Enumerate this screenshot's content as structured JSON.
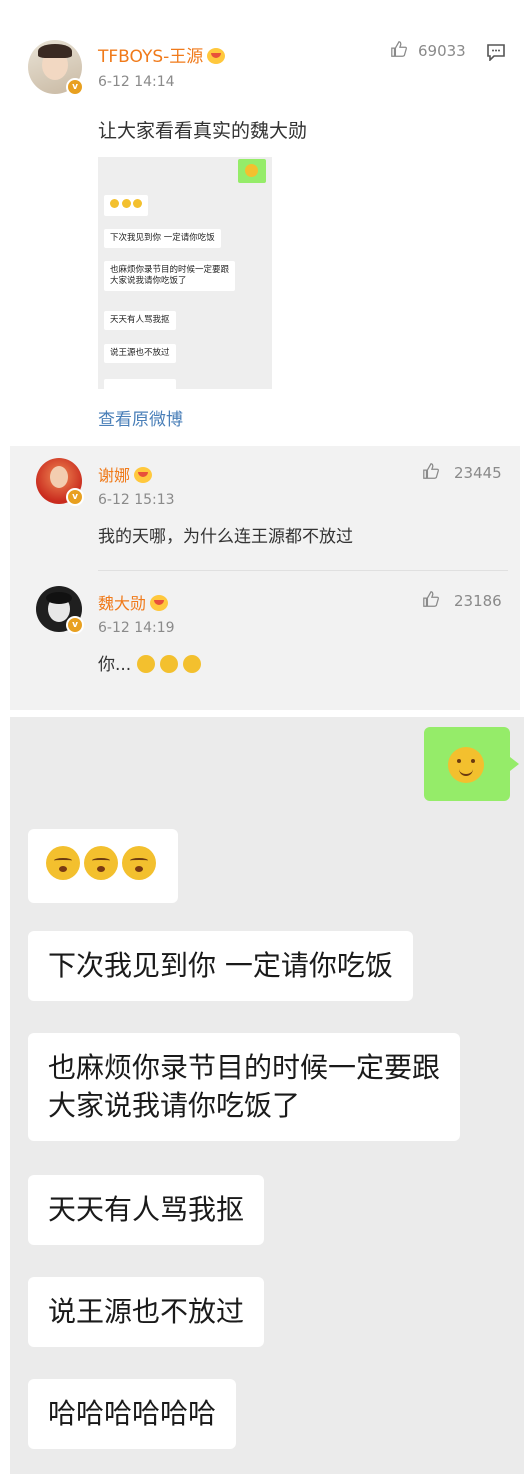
{
  "post": {
    "username": "TFBOYS-王源",
    "time": "6-12 14:14",
    "likes": "69033",
    "text": "让大家看看真实的魏大勋",
    "view_original": "查看原微博",
    "mini_chat": {
      "messages": [
        "下次我见到你 一定请你吃饭",
        "也麻烦你录节目的时候一定要跟\n大家说我请你吃饭了",
        "天天有人骂我抠",
        "说王源也不放过"
      ]
    }
  },
  "comments": [
    {
      "username": "谢娜",
      "time": "6-12 15:13",
      "likes": "23445",
      "text": "我的天哪，为什么连王源都不放过"
    },
    {
      "username": "魏大勋",
      "time": "6-12 14:19",
      "likes": "23186",
      "text": "你..."
    }
  ],
  "chat": {
    "messages": [
      "下次我见到你 一定请你吃饭",
      "也麻烦你录节目的时候一定要跟\n大家说我请你吃饭了",
      "天天有人骂我抠",
      "说王源也不放过",
      "哈哈哈哈哈哈"
    ]
  },
  "colors": {
    "username": "#f07a1a",
    "sent_bubble": "#95ec69",
    "chat_bg": "#ebebeb"
  }
}
